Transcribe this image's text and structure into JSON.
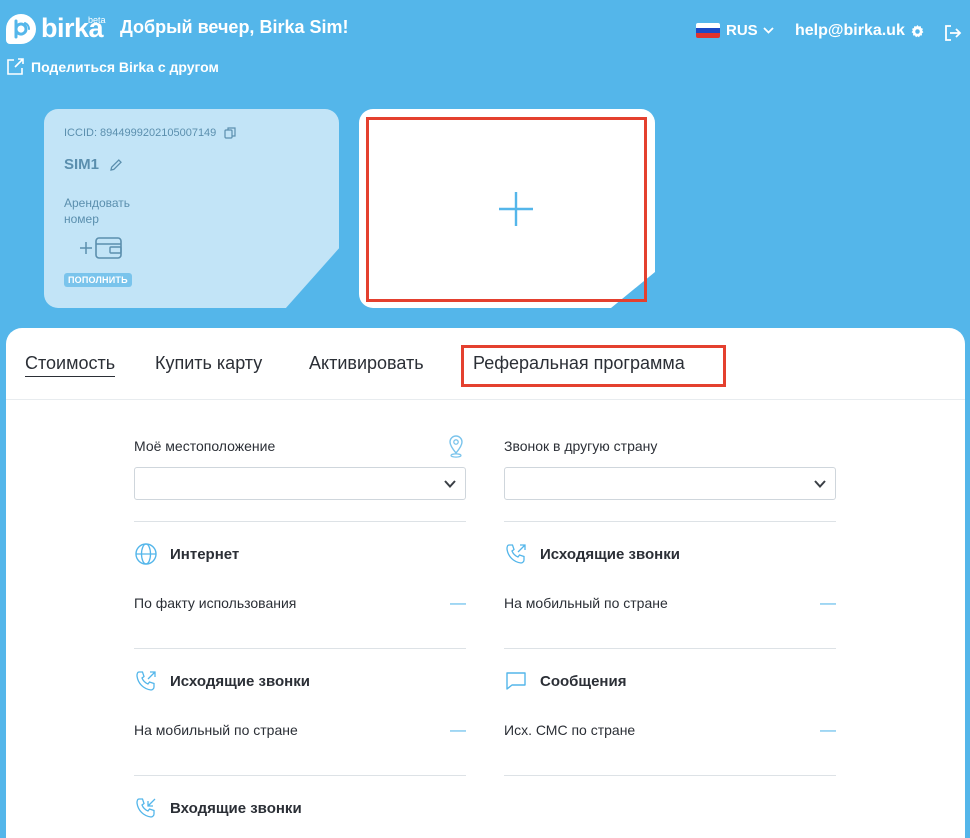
{
  "header": {
    "logo_text": "birka",
    "logo_beta": "beta",
    "greeting": "Добрый вечер, Birka Sim!",
    "language": "RUS",
    "email": "help@birka.uk",
    "share_label": "Поделиться Birka с другом"
  },
  "sim_card": {
    "iccid": "ICCID: 8944999202105007149",
    "name": "SIM1",
    "rent_label": "Арендовать номер",
    "topup_label": "ПОПОЛНИТЬ"
  },
  "tabs": [
    {
      "label": "Стоимость"
    },
    {
      "label": "Купить карту"
    },
    {
      "label": "Активировать"
    },
    {
      "label": "Реферальная программа"
    }
  ],
  "pricing": {
    "location_label": "Моё местоположение",
    "location_value": "",
    "destination_label": "Звонок в другую страну",
    "destination_value": "",
    "left_sections": [
      {
        "title": "Интернет",
        "row_label": "По факту использования",
        "row_value": "—"
      },
      {
        "title": "Исходящие звонки",
        "row_label": "На мобильный по стране",
        "row_value": "—"
      },
      {
        "title": "Входящие звонки"
      }
    ],
    "right_sections": [
      {
        "title": "Исходящие звонки",
        "row_label": "На мобильный по стране",
        "row_value": "—"
      },
      {
        "title": "Сообщения",
        "row_label": "Исх. СМС по стране",
        "row_value": "—"
      }
    ]
  },
  "colors": {
    "background": "#54b6ea",
    "highlight": "#e4402f",
    "sim_card": "#c2e4f7"
  }
}
